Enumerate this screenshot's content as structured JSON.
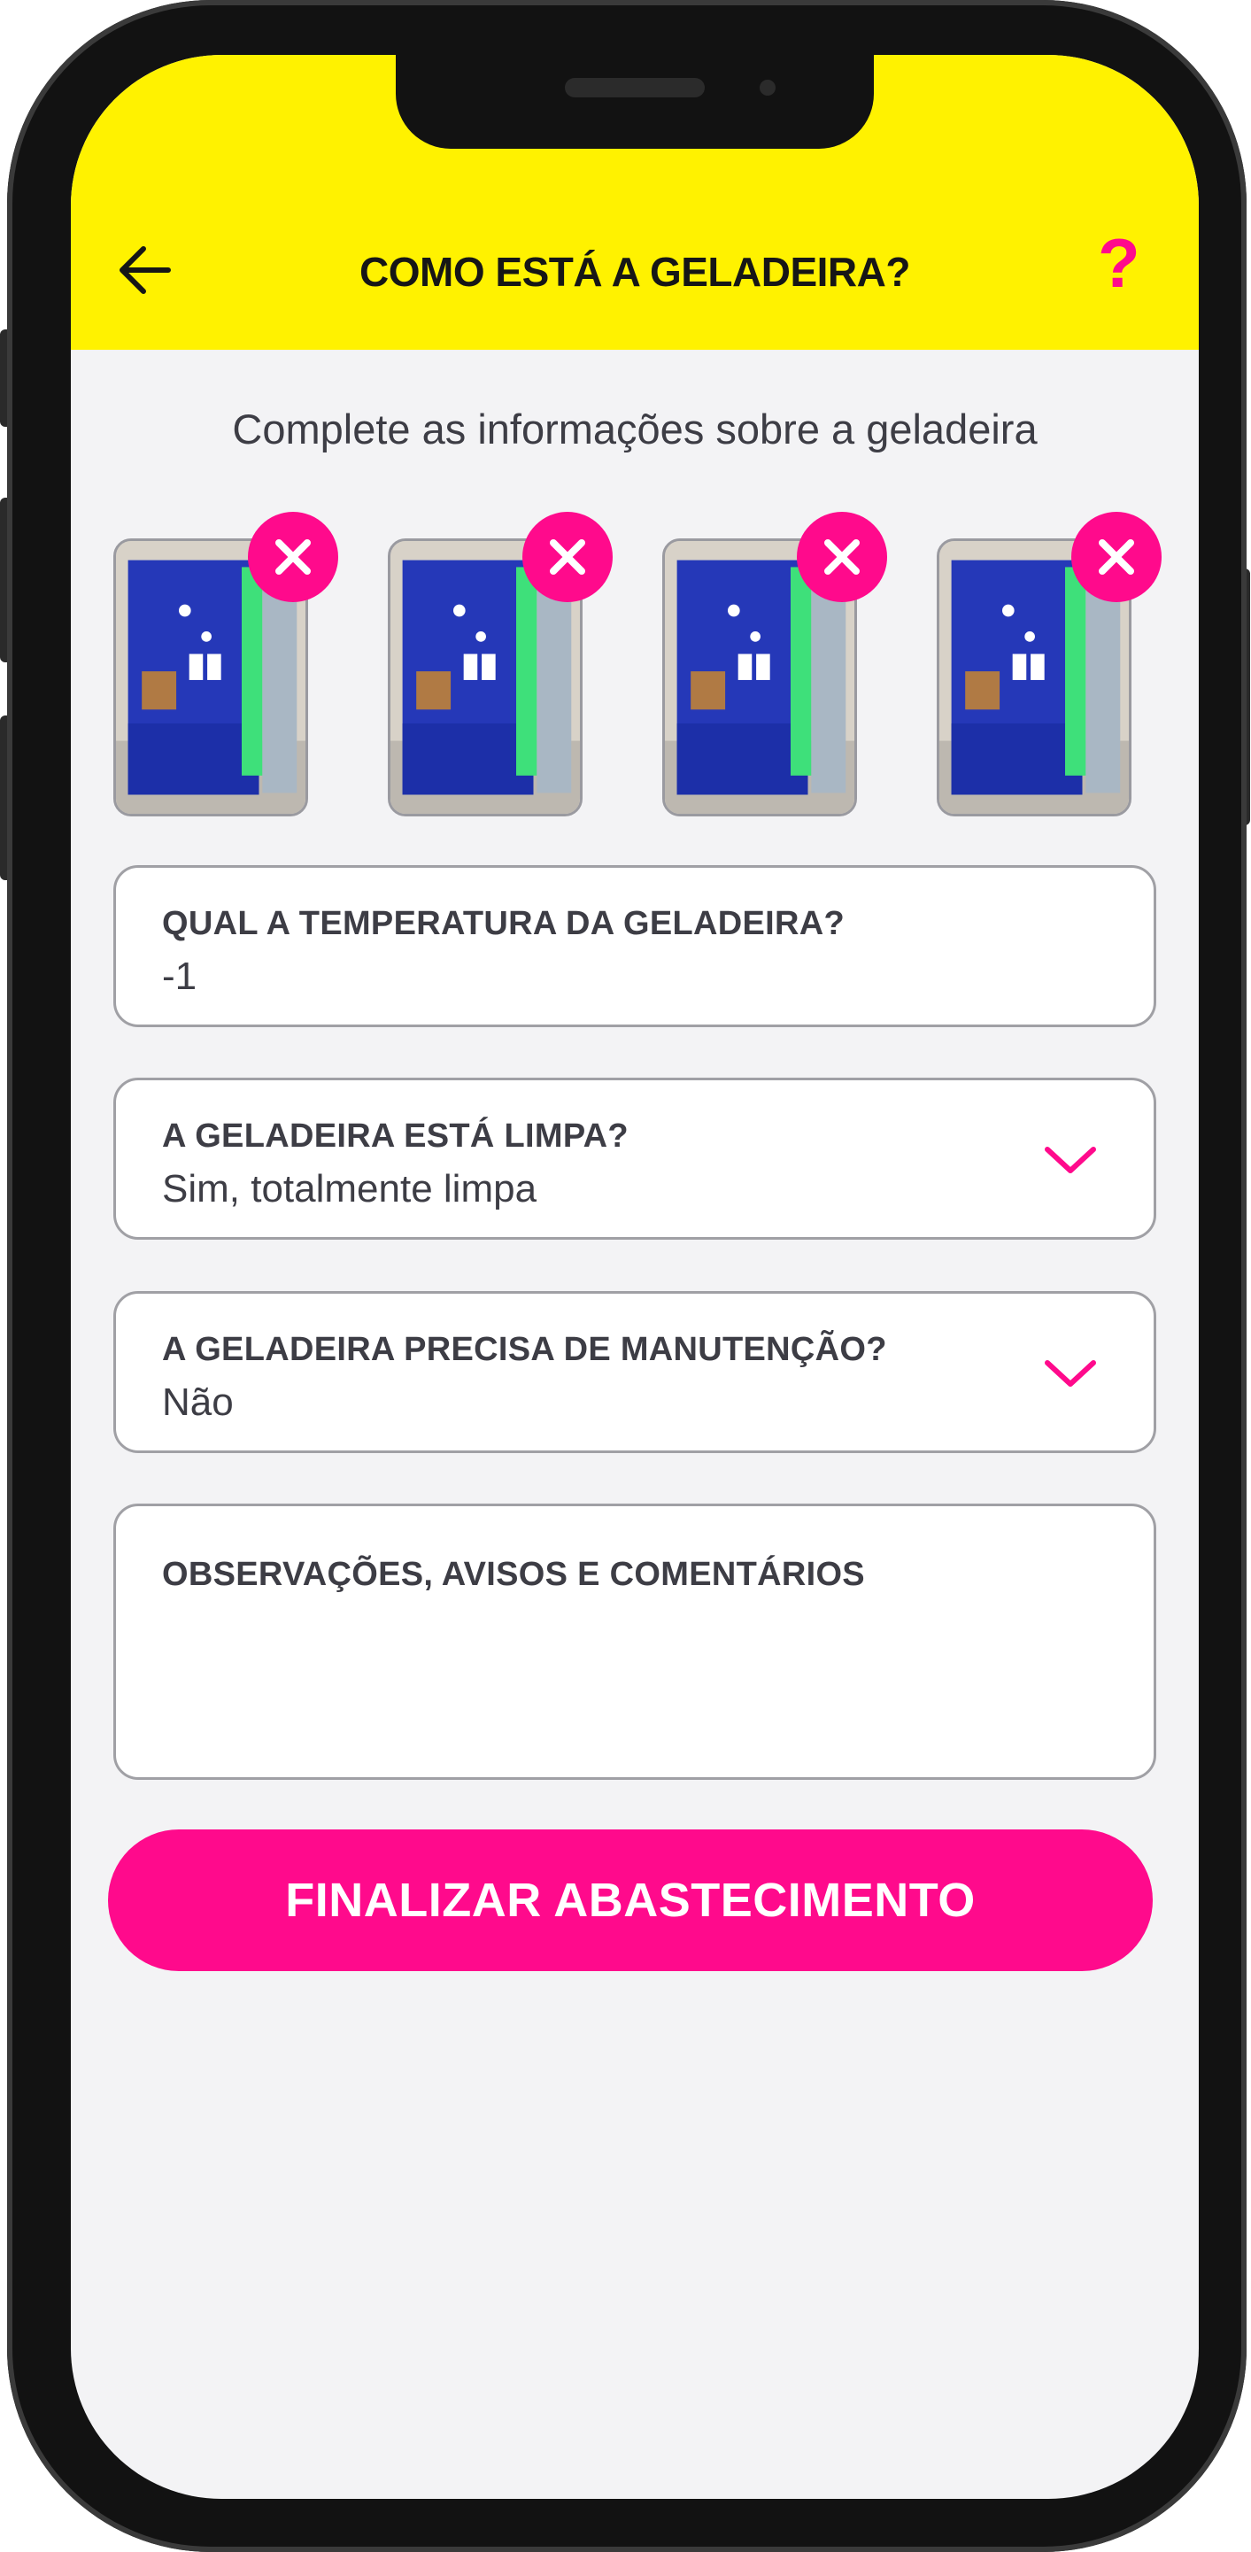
{
  "header": {
    "title": "COMO ESTÁ A GELADEIRA?",
    "help_label": "?",
    "back_icon": "arrow-left-icon",
    "background_color": "#fff200",
    "accent_color": "#ff0a8c"
  },
  "subtitle": "Complete as informações sobre a geladeira",
  "photos": {
    "count": 4,
    "remove_icon": "close-icon"
  },
  "form": {
    "temperature": {
      "label": "QUAL A TEMPERATURA DA GELADEIRA?",
      "value": "-1"
    },
    "clean": {
      "label": "A GELADEIRA ESTÁ LIMPA?",
      "value": "Sim, totalmente limpa",
      "icon": "chevron-down-icon"
    },
    "maintenance": {
      "label": "A GELADEIRA PRECISA DE MANUTENÇÃO?",
      "value": "Não",
      "icon": "chevron-down-icon"
    },
    "notes": {
      "label": "OBSERVAÇÕES, AVISOS E COMENTÁRIOS",
      "value": ""
    }
  },
  "submit_label": "FINALIZAR ABASTECIMENTO"
}
